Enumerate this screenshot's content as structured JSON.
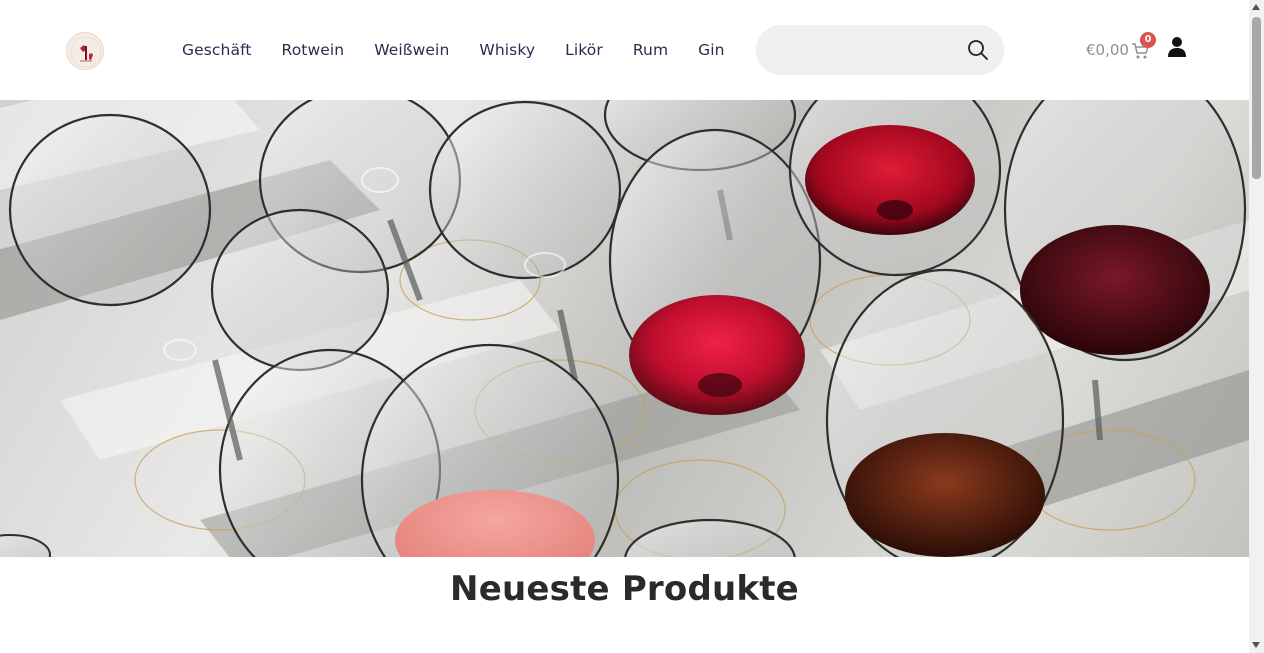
{
  "header": {
    "logo": "wine-shop-logo",
    "nav": [
      {
        "label": "Geschäft"
      },
      {
        "label": "Rotwein"
      },
      {
        "label": "Weißwein"
      },
      {
        "label": "Whisky"
      },
      {
        "label": "Likör"
      },
      {
        "label": "Rum"
      },
      {
        "label": "Gin"
      }
    ],
    "search": {
      "value": "",
      "placeholder": "",
      "icon": "search-icon"
    },
    "cart": {
      "total": "€0,00",
      "count": "0",
      "icon": "cart-icon"
    },
    "account": {
      "icon": "user-icon"
    }
  },
  "hero": {
    "image": "wine-glasses-photo"
  },
  "main": {
    "section_title": "Neueste Produkte"
  },
  "colors": {
    "nav_text": "#2a2d4f",
    "search_bg": "#efefef",
    "badge": "#d9534f",
    "cart_text": "#8a8f9c",
    "title_text": "#2a2a2a"
  }
}
